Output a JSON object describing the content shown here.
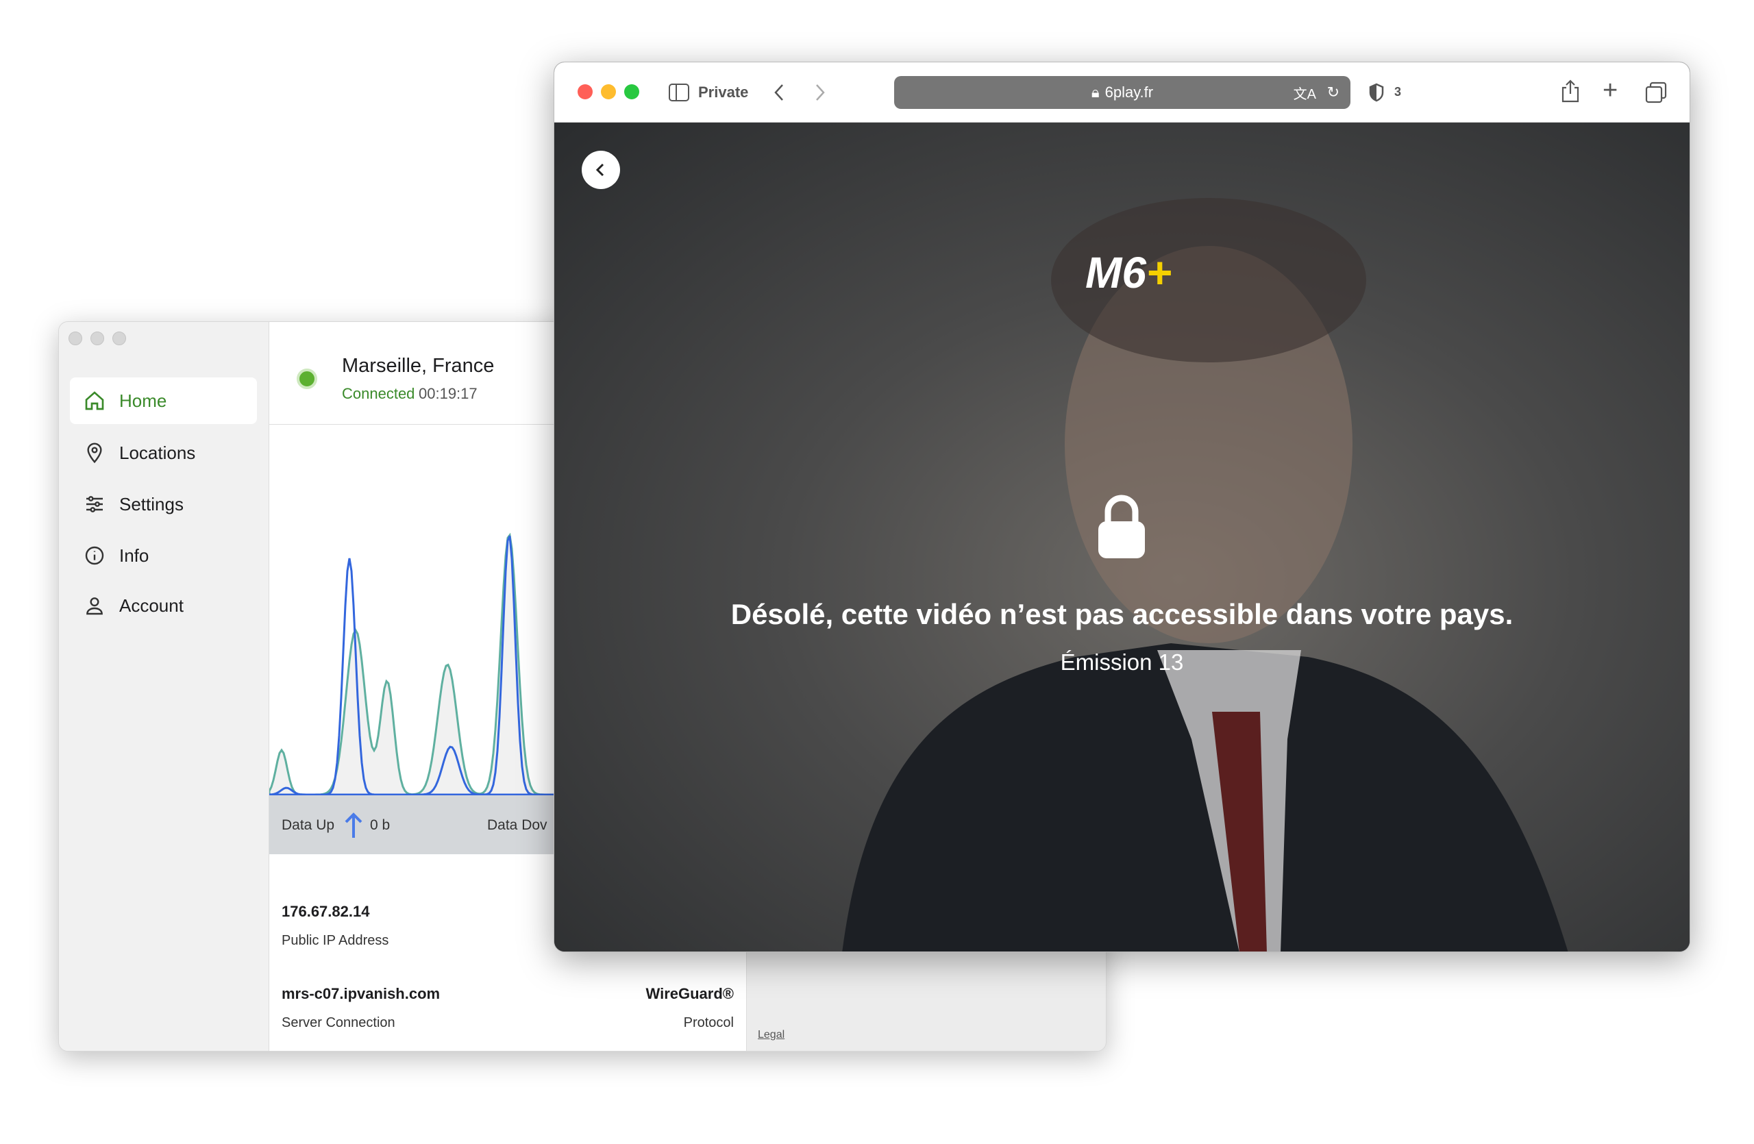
{
  "vpn": {
    "nav": [
      {
        "label": "Home",
        "icon": "home-icon"
      },
      {
        "label": "Locations",
        "icon": "pin-icon"
      },
      {
        "label": "Settings",
        "icon": "sliders-icon"
      },
      {
        "label": "Info",
        "icon": "info-icon"
      },
      {
        "label": "Account",
        "icon": "user-icon"
      }
    ],
    "location": "Marseille, France",
    "status": "Connected",
    "duration": "00:19:17",
    "data_up_label": "Data Up",
    "data_up_value": "0 b",
    "data_down_label": "Data Dov",
    "ip": "176.67.82.14",
    "ip_label": "Public IP Address",
    "server": "mrs-c07.ipvanish.com",
    "server_label": "Server Connection",
    "protocol": "WireGuard®",
    "protocol_label": "Protocol",
    "legal": "Legal",
    "zoom_in": "+",
    "zoom_out": "−",
    "colors": {
      "accent": "#3a8a2a",
      "up_series": "#3366dd",
      "down_series": "#5fb0a0"
    }
  },
  "browser": {
    "private_label": "Private",
    "url": "6play.fr",
    "shield_count": "3",
    "logo_text": "M6+",
    "message": "Désolé, cette vidéo n’est pas accessible dans votre pays.",
    "subtitle": "Émission 13"
  }
}
